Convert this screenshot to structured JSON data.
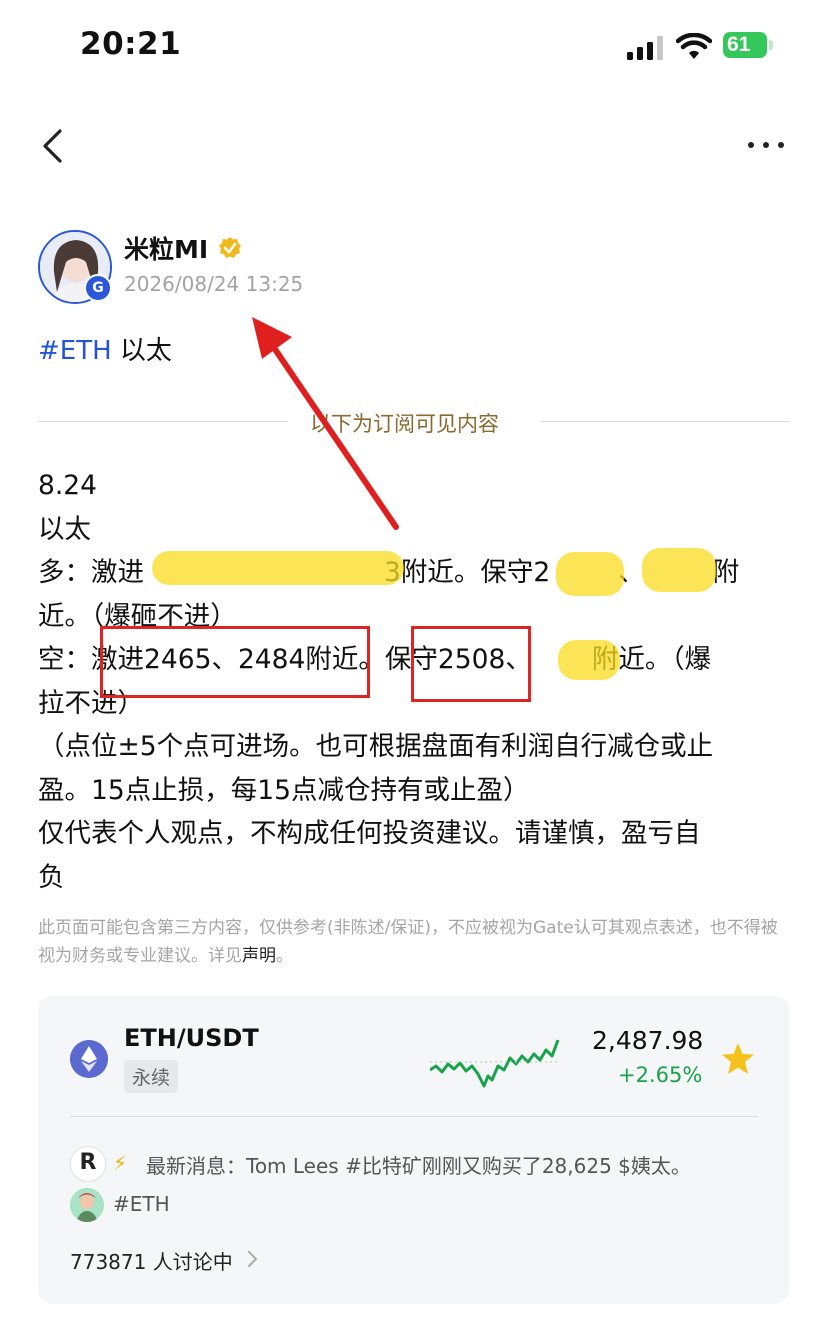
{
  "status_bar": {
    "time": "20:21",
    "battery": "61"
  },
  "post": {
    "author": "米粒MI",
    "timestamp": "2026/08/24 13:25",
    "hashtag": "#ETH",
    "hashtag_suffix": " 以太",
    "subscription_divider": "以下为订阅可见内容",
    "lines": [
      "8.24",
      "以太",
      "多：激进",
      "3附近。保守2",
      "、",
      "附",
      "近。（爆砸不进）",
      "空：激进2465、2484附近。保守2508、",
      "附近。（爆",
      "拉不进）",
      "（点位±5个点可进场。也可根据盘面有利润自行减仓或止",
      "盈。15点止损，每15点减仓持有或止盈）",
      "仅代表个人观点，不构成任何投资建议。请谨慎，盈亏自",
      "负"
    ],
    "disclaimer_text": "此页面可能包含第三方内容，仅供参考(非陈述/保证)，不应被视为Gate认可其观点表述，也不得被视为财务或专业建议。详见",
    "disclaimer_link": "声明",
    "disclaimer_end": "。"
  },
  "market_card": {
    "pair": "ETH/USDT",
    "badge": "永续",
    "price": "2,487.98",
    "change": "+2.65%",
    "news_prefix": "最新消息：",
    "news_text": "Tom Lees #比特矿刚刚又购买了28,625 $姨太。",
    "topic": "#ETH",
    "discussion_count": "773871",
    "discussion_label": "人讨论中",
    "colors": {
      "up": "#17a34a",
      "star": "#f5c21b"
    }
  },
  "icons": [
    "back-icon",
    "more-icon",
    "verified-icon",
    "eth-icon",
    "sparkline",
    "star-icon",
    "lightning-icon",
    "chevron-right-icon"
  ]
}
